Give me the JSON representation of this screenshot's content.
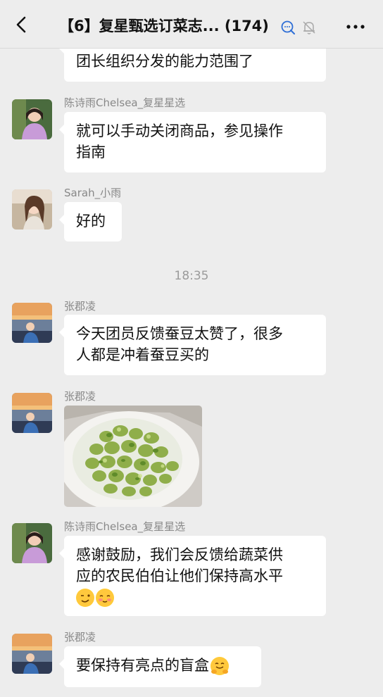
{
  "header": {
    "back_icon": "chevron-left-icon",
    "title": "【6】复星甄选订菜志... (174)",
    "status_icons": [
      "chat-search-icon",
      "mute-bell-icon"
    ],
    "more_icon": "more-dots-icon"
  },
  "messages": [
    {
      "type": "text",
      "sender": "",
      "text": "团长组织分发的能力范围了",
      "partial": true
    },
    {
      "type": "text",
      "sender": "陈诗雨Chelsea_复星星选",
      "text": "就可以手动关闭商品，参见操作\n指南"
    },
    {
      "type": "text",
      "sender": "Sarah_小雨",
      "text": "好的"
    },
    {
      "type": "time",
      "text": "18:35"
    },
    {
      "type": "text",
      "sender": "张郡凌",
      "text": "今天团员反馈蚕豆太赞了，很多\n人都是冲着蚕豆买的"
    },
    {
      "type": "image",
      "sender": "张郡凌",
      "image": "fava-beans-photo"
    },
    {
      "type": "text",
      "sender": "陈诗雨Chelsea_复星星选",
      "text": "感谢鼓励，我们会反馈给蔬菜供\n应的农民伯伯让他们保持高水平",
      "emojis": [
        "wink-emoji",
        "blush-emoji"
      ]
    },
    {
      "type": "text",
      "sender": "张郡凌",
      "text": "要保持有亮点的盲盒",
      "emojis": [
        "hug-emoji"
      ]
    }
  ],
  "colors": {
    "background": "#ededed",
    "bubble": "#ffffff",
    "nickname": "#888888",
    "accent": "#2f6fd6"
  }
}
